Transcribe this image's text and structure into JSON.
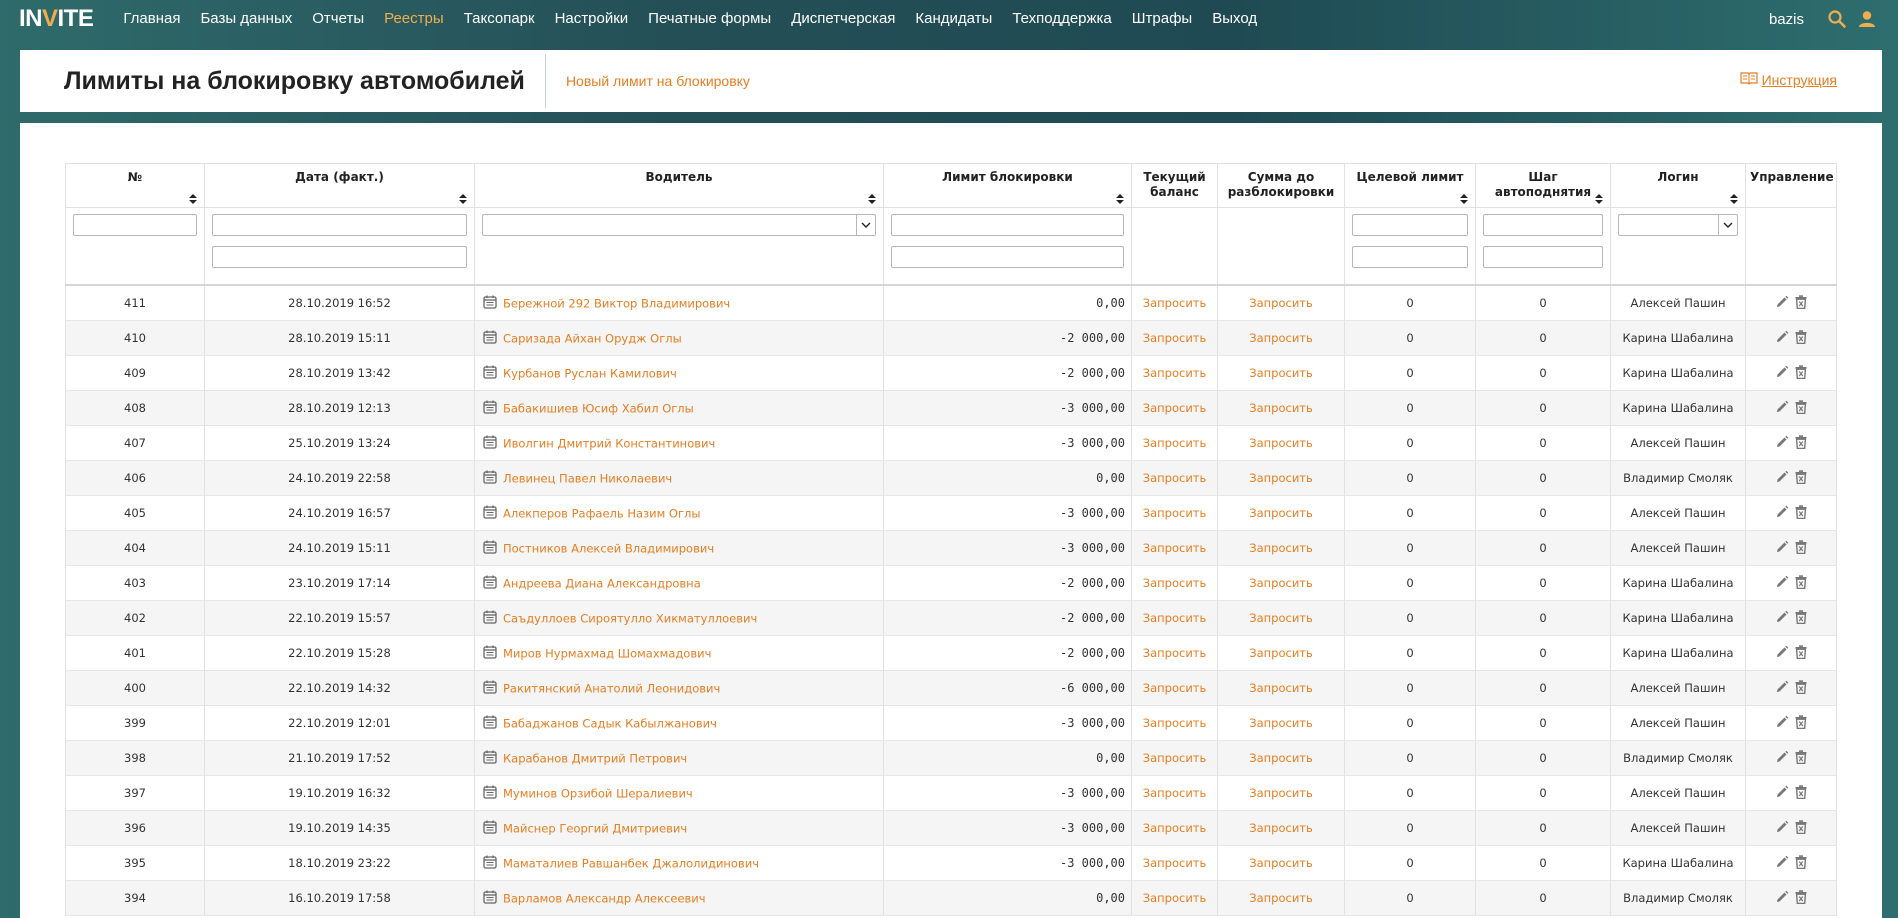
{
  "app": {
    "logo_text_1": "IN",
    "logo_dot": "V",
    "logo_text_2": "ITE",
    "brand_accent": "#f0ad4e"
  },
  "nav": [
    {
      "label": "Главная",
      "active": false
    },
    {
      "label": "Базы данных",
      "active": false
    },
    {
      "label": "Отчеты",
      "active": false
    },
    {
      "label": "Реестры",
      "active": true
    },
    {
      "label": "Таксопарк",
      "active": false
    },
    {
      "label": "Настройки",
      "active": false
    },
    {
      "label": "Печатные формы",
      "active": false
    },
    {
      "label": "Диспетчерская",
      "active": false
    },
    {
      "label": "Кандидаты",
      "active": false
    },
    {
      "label": "Техподдержка",
      "active": false
    },
    {
      "label": "Штрафы",
      "active": false
    },
    {
      "label": "Выход",
      "active": false
    }
  ],
  "user": {
    "name": "bazis",
    "search_icon": "search-icon",
    "profile_icon": "user-icon"
  },
  "header": {
    "title": "Лимиты на блокировку автомобилей",
    "new_limit_link": "Новый лимит на блокировку",
    "instructions_link": "Инструкция"
  },
  "table": {
    "columns": [
      {
        "label": "№",
        "sortable": true
      },
      {
        "label": "Дата (факт.)",
        "sortable": true
      },
      {
        "label": "Водитель",
        "sortable": true
      },
      {
        "label": "Лимит блокировки",
        "sortable": true
      },
      {
        "label": "Текущий баланс",
        "sortable": false
      },
      {
        "label": "Сумма до разблокировки",
        "sortable": false
      },
      {
        "label": "Целевой лимит",
        "sortable": true
      },
      {
        "label": "Шаг автоподнятия",
        "sortable": true
      },
      {
        "label": "Логин",
        "sortable": true
      },
      {
        "label": "Управление",
        "sortable": false
      }
    ],
    "request_label": "Запросить",
    "rows": [
      {
        "id": "411",
        "date": "28.10.2019 16:52",
        "driver": "Бережной 292 Виктор Владимирович",
        "limit": "0,00",
        "target": "0",
        "step": "0",
        "login": "Алексей Пашин"
      },
      {
        "id": "410",
        "date": "28.10.2019 15:11",
        "driver": "Саризада Айхан Орудж Оглы",
        "limit": "-2 000,00",
        "target": "0",
        "step": "0",
        "login": "Карина Шабалина"
      },
      {
        "id": "409",
        "date": "28.10.2019 13:42",
        "driver": "Курбанов Руслан Камилович",
        "limit": "-2 000,00",
        "target": "0",
        "step": "0",
        "login": "Карина Шабалина"
      },
      {
        "id": "408",
        "date": "28.10.2019 12:13",
        "driver": "Бабакишиев Юсиф Хабил Оглы",
        "limit": "-3 000,00",
        "target": "0",
        "step": "0",
        "login": "Карина Шабалина"
      },
      {
        "id": "407",
        "date": "25.10.2019 13:24",
        "driver": "Иволгин Дмитрий Константинович",
        "limit": "-3 000,00",
        "target": "0",
        "step": "0",
        "login": "Алексей Пашин"
      },
      {
        "id": "406",
        "date": "24.10.2019 22:58",
        "driver": "Левинец Павел Николаевич",
        "limit": "0,00",
        "target": "0",
        "step": "0",
        "login": "Владимир Смоляк"
      },
      {
        "id": "405",
        "date": "24.10.2019 16:57",
        "driver": "Алекперов Рафаель Назим Оглы",
        "limit": "-3 000,00",
        "target": "0",
        "step": "0",
        "login": "Алексей Пашин"
      },
      {
        "id": "404",
        "date": "24.10.2019 15:11",
        "driver": "Постников Алексей Владимирович",
        "limit": "-3 000,00",
        "target": "0",
        "step": "0",
        "login": "Алексей Пашин"
      },
      {
        "id": "403",
        "date": "23.10.2019 17:14",
        "driver": "Андреева Диана Александровна",
        "limit": "-2 000,00",
        "target": "0",
        "step": "0",
        "login": "Карина Шабалина"
      },
      {
        "id": "402",
        "date": "22.10.2019 15:57",
        "driver": "Саъдуллоев Сироятулло Хикматуллоевич",
        "limit": "-2 000,00",
        "target": "0",
        "step": "0",
        "login": "Карина Шабалина"
      },
      {
        "id": "401",
        "date": "22.10.2019 15:28",
        "driver": "Миров Нурмахмад Шомахмадович",
        "limit": "-2 000,00",
        "target": "0",
        "step": "0",
        "login": "Карина Шабалина"
      },
      {
        "id": "400",
        "date": "22.10.2019 14:32",
        "driver": "Ракитянский Анатолий Леонидович",
        "limit": "-6 000,00",
        "target": "0",
        "step": "0",
        "login": "Алексей Пашин"
      },
      {
        "id": "399",
        "date": "22.10.2019 12:01",
        "driver": "Бабаджанов Садык Кабылжанович",
        "limit": "-3 000,00",
        "target": "0",
        "step": "0",
        "login": "Алексей Пашин"
      },
      {
        "id": "398",
        "date": "21.10.2019 17:52",
        "driver": "Карабанов Дмитрий Петрович",
        "limit": "0,00",
        "target": "0",
        "step": "0",
        "login": "Владимир Смоляк"
      },
      {
        "id": "397",
        "date": "19.10.2019 16:32",
        "driver": "Муминов Орзибой Шералиевич",
        "limit": "-3 000,00",
        "target": "0",
        "step": "0",
        "login": "Алексей Пашин"
      },
      {
        "id": "396",
        "date": "19.10.2019 14:35",
        "driver": "Майснер Георгий Дмитриевич",
        "limit": "-3 000,00",
        "target": "0",
        "step": "0",
        "login": "Алексей Пашин"
      },
      {
        "id": "395",
        "date": "18.10.2019 23:22",
        "driver": "Маматалиев Равшанбек Джалолидинович",
        "limit": "-3 000,00",
        "target": "0",
        "step": "0",
        "login": "Карина Шабалина"
      },
      {
        "id": "394",
        "date": "16.10.2019 17:58",
        "driver": "Варламов Александр Алексеевич",
        "limit": "0,00",
        "target": "0",
        "step": "0",
        "login": "Владимир Смоляк"
      }
    ]
  },
  "colors": {
    "link": "#e67e22",
    "row_alt": "#f5f5f5"
  }
}
